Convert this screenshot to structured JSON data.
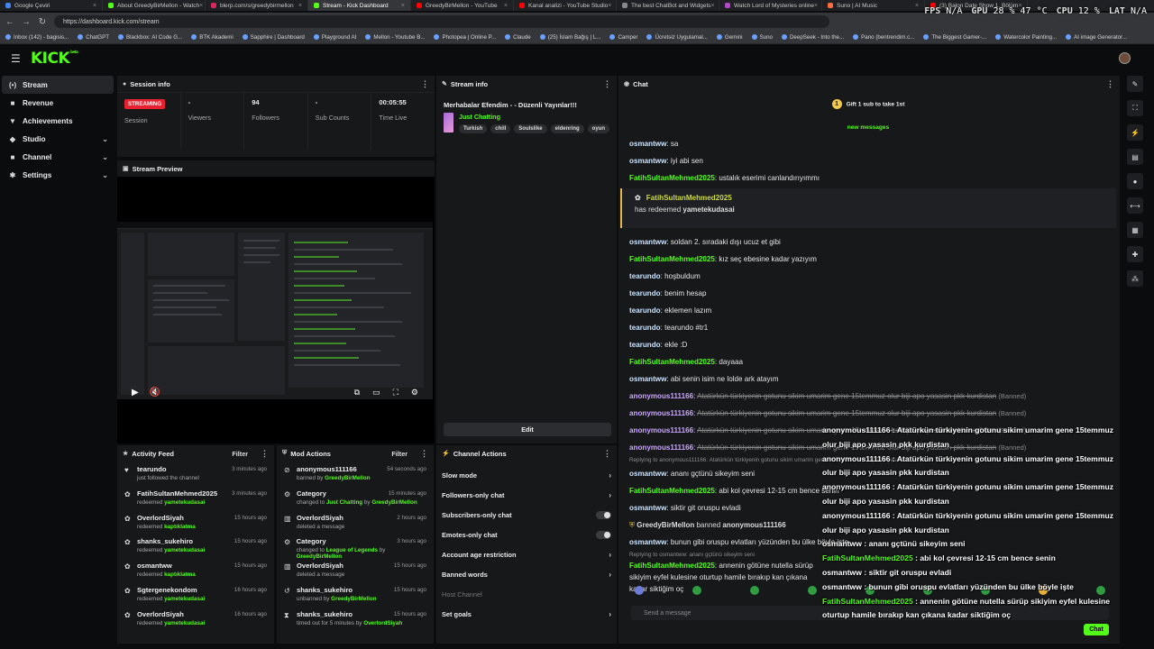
{
  "browser": {
    "tabs": [
      {
        "label": "Google Çeviri",
        "color": "#4285f4"
      },
      {
        "label": "About GreedyBirMellon - Watch",
        "color": "#53fc18"
      },
      {
        "label": "blerp.com/s/greedybirmellon",
        "color": "#e0245e"
      },
      {
        "label": "Stream - Kick Dashboard",
        "color": "#53fc18",
        "active": true
      },
      {
        "label": "GreedyBirMellon - YouTube",
        "color": "#ff0000"
      },
      {
        "label": "Kanal analizi - YouTube Studio",
        "color": "#ff0000"
      },
      {
        "label": "The best ChatBot and Widgets",
        "color": "#888888"
      },
      {
        "label": "Watch Lord of Mysteries online",
        "color": "#b048c8"
      },
      {
        "label": "Suno | AI Music",
        "color": "#ff6b3d"
      },
      {
        "label": "(3) Balon Date Show 1. Bölüm",
        "color": "#ff0000"
      }
    ],
    "url": "https://dashboard.kick.com/stream",
    "bookmarks": [
      "Inbox (142) - bagisis...",
      "ChatGPT",
      "Blackbox: AI Code G...",
      "BTK Akademi",
      "Sapphire | Dashboard",
      "Playground AI",
      "Mellon - Youtube B...",
      "Photopea | Online P...",
      "Claude",
      "(25) İslam Bağış | L...",
      "Camper",
      "Ücretsiz Uygulamal...",
      "Gemini",
      "Suno",
      "DeepSeek - Into the...",
      "Pano (bentrendim.c...",
      "The Biggest Gamer-...",
      "Watercolor Painting...",
      "AI image Generator..."
    ]
  },
  "hud": {
    "fps_label": "FPS",
    "fps": "N/A",
    "gpu_label": "GPU",
    "gpu": "28 % 47 °C",
    "cpu_label": "CPU",
    "cpu": "12 %",
    "lat_label": "LAT",
    "lat": "N/A"
  },
  "brand": {
    "logo": "KICK",
    "logo_sup": "beta"
  },
  "sidebar": {
    "items": [
      {
        "label": "Stream",
        "icon": "stream-icon",
        "glyph": "(•)",
        "active": true
      },
      {
        "label": "Revenue",
        "icon": "revenue-icon",
        "glyph": "■"
      },
      {
        "label": "Achievements",
        "icon": "trophy-icon",
        "glyph": "▼"
      },
      {
        "label": "Studio",
        "icon": "studio-icon",
        "glyph": "◆",
        "chevron": true
      },
      {
        "label": "Channel",
        "icon": "channel-icon",
        "glyph": "■",
        "chevron": true
      },
      {
        "label": "Settings",
        "icon": "gear-icon",
        "glyph": "✱",
        "chevron": true
      }
    ]
  },
  "session": {
    "title": "Session info",
    "status": "STREAMING",
    "status_label": "Session",
    "viewers": "-",
    "viewers_label": "Viewers",
    "followers": "94",
    "followers_label": "Followers",
    "subs": "-",
    "subs_label": "Sub Counts",
    "time": "00:05:55",
    "time_label": "Time Live"
  },
  "preview": {
    "title": "Stream Preview"
  },
  "streaminfo": {
    "title": "Stream info",
    "stream_title": "Merhabalar Efendim - - Düzenli Yayınlar!!!",
    "category": "Just Chatting",
    "tags": [
      "Turkish",
      "chill",
      "Soulslike",
      "eldenring",
      "oyun"
    ],
    "edit": "Edit"
  },
  "chat": {
    "title": "Chat",
    "gift": "Gift 1 sub to take 1st",
    "new_messages": "new messages",
    "messages": [
      {
        "u": "osmantww",
        "c": "#c9e3ff",
        "t": "sa"
      },
      {
        "u": "osmantww",
        "c": "#c9e3ff",
        "t": "iyi abi sen"
      },
      {
        "u": "FatihSultanMehmed2025",
        "c": "#53fc18",
        "t": "ustalık eserimi canlandırıyımmı"
      }
    ],
    "redeem": {
      "u": "FatihSultanMehmed2025",
      "t1": "has redeemed ",
      "t2": "yametekudasai"
    },
    "messages2": [
      {
        "u": "osmantww",
        "c": "#c9e3ff",
        "t": "soldan 2. sıradaki dışı ucuz et gibi"
      },
      {
        "u": "FatihSultanMehmed2025",
        "c": "#53fc18",
        "t": "kız seç ebesine kadar yazıyım"
      },
      {
        "u": "tearundo",
        "c": "#c9e3ff",
        "t": "hoşbuldum"
      },
      {
        "u": "tearundo",
        "c": "#c9e3ff",
        "t": "benim hesap"
      },
      {
        "u": "tearundo",
        "c": "#c9e3ff",
        "t": "eklemen lazım"
      },
      {
        "u": "tearundo",
        "c": "#c9e3ff",
        "t": "tearundo #tr1"
      },
      {
        "u": "tearundo",
        "c": "#c9e3ff",
        "t": "ekle :D"
      },
      {
        "u": "FatihSultanMehmed2025",
        "c": "#53fc18",
        "t": "dayaaa"
      },
      {
        "u": "osmantww",
        "c": "#c9e3ff",
        "t": "abi senin isim ne lolde ark atayım"
      }
    ],
    "banned_msgs": [
      {
        "u": "anonymous111166",
        "t": "Atatürkün türkiyenin gotunu sikim umarim gene 15temmuz olur biji apo yasasin pkk kurdistan",
        "b": "(Banned)"
      },
      {
        "u": "anonymous111166",
        "t": "Atatürkün türkiyenin gotunu sikim umarim gene 15temmuz olur biji apo yasasin pkk kurdistan",
        "b": "(Banned)"
      },
      {
        "u": "anonymous111166",
        "t": "Atatürkün türkiyenin gotunu sikim umarim gene 15temmuz olur biji apo yasasin pkk kurdistan",
        "b": "(Banned)"
      },
      {
        "u": "anonymous111166",
        "t": "Atatürkün türkiyenin gotunu sikim umarim gene 15temmuz olur biji apo yasasin pkk kurdistan",
        "b": "(Banned)"
      }
    ],
    "reply1": "Replying to anonymous111166: Atatürkün türkiyenin gotunu sikim umarim gene 15temmuz olur biji apo yasasin...",
    "messages3": [
      {
        "u": "osmantww",
        "c": "#c9e3ff",
        "t": "ananı gçtünü sikeyim seni"
      },
      {
        "u": "FatihSultanMehmed2025",
        "c": "#53fc18",
        "t": "abi kol çevresi 12-15 cm bence senin"
      },
      {
        "u": "osmantww",
        "c": "#c9e3ff",
        "t": "siktir git oruspu evladi"
      }
    ],
    "mod": {
      "u": "GreedyBirMellon",
      "action": "banned",
      "target": "anonymous111166"
    },
    "messages4": [
      {
        "u": "osmantww",
        "c": "#c9e3ff",
        "t": "bunun gibi oruspu evlatları yüzünden bu ülke böyle işte"
      }
    ],
    "reply2": "Replying to osmantww: ananı gçtünü sikeyim seni",
    "last": {
      "u": "FatihSultanMehmed2025",
      "t": "annenin götüne nutella sürüp sikiyim eyfel kulesine oturtup hamile bırakıp kan çıkana kadar siktiğim oç"
    },
    "input_placeholder": "Send a message",
    "send": "Chat"
  },
  "overlay": [
    {
      "u": "anonymous111166",
      "t": "Atatürkün türkiyenin gotunu sikim umarim gene 15temmuz olur biji apo yasasin pkk kurdistan"
    },
    {
      "u": "anonymous111166",
      "t": "Atatürkün türkiyenin gotunu sikim umarim gene 15temmuz olur biji apo yasasin pkk kurdistan"
    },
    {
      "u": "anonymous111166",
      "t": "Atatürkün türkiyenin gotunu sikim umarim gene 15temmuz olur biji apo yasasin pkk kurdistan"
    },
    {
      "u": "anonymous111166",
      "t": "Atatürkün türkiyenin gotunu sikim umarim gene 15temmuz olur biji apo yasasin pkk kurdistan"
    },
    {
      "u": "osmantww",
      "t": "ananı gçtünü sikeyim seni"
    },
    {
      "u": "FatihSultanMehmed2025",
      "t": "abi kol çevresi 12-15 cm bence senin",
      "g": true
    },
    {
      "u": "osmantww",
      "t": "siktir git oruspu evladi"
    },
    {
      "u": "osmantww",
      "t": "bunun gibi oruspu evlatları yüzünden bu ülke böyle işte"
    },
    {
      "u": "FatihSultanMehmed2025",
      "t": "annenin götüne nutella sürüp sikiyim eyfel kulesine oturtup hamile bırakıp kan çıkana kadar siktiğim oç",
      "g": true
    }
  ],
  "activity": {
    "title": "Activity Feed",
    "filter": "Filter",
    "items": [
      {
        "icon": "heart-icon",
        "glyph": "♥",
        "name": "tearundo",
        "sub": "just followed the channel",
        "time": "3 minutes ago"
      },
      {
        "icon": "redeem-icon",
        "glyph": "✿",
        "name": "FatihSultanMehmed2025",
        "sub_pre": "redeemed ",
        "sub_b": "yametekudasai",
        "time": "3 minutes ago"
      },
      {
        "icon": "redeem-icon",
        "glyph": "✿",
        "name": "OverlordSiyah",
        "sub_pre": "redeemed ",
        "sub_b": "kaptıklatma",
        "time": "15 hours ago"
      },
      {
        "icon": "redeem-icon",
        "glyph": "✿",
        "name": "shanks_sukehiro",
        "sub_pre": "redeemed ",
        "sub_b": "yametekudasai",
        "time": "15 hours ago"
      },
      {
        "icon": "redeem-icon",
        "glyph": "✿",
        "name": "osmantww",
        "sub_pre": "redeemed ",
        "sub_b": "kaptıklatma",
        "time": "15 hours ago"
      },
      {
        "icon": "redeem-icon",
        "glyph": "✿",
        "name": "Sgtergenekondom",
        "sub_pre": "redeemed ",
        "sub_b": "yametekudasai",
        "time": "16 hours ago"
      },
      {
        "icon": "redeem-icon",
        "glyph": "✿",
        "name": "OverlordSiyah",
        "sub_pre": "redeemed ",
        "sub_b": "yametekudasai",
        "time": "16 hours ago"
      }
    ]
  },
  "mod": {
    "title": "Mod Actions",
    "filter": "Filter",
    "items": [
      {
        "icon": "ban-icon",
        "glyph": "⊘",
        "name": "anonymous111166",
        "sub_pre": "banned by ",
        "sub_b": "GreedyBirMellon",
        "time": "54 seconds ago"
      },
      {
        "icon": "category-icon",
        "glyph": "⚙",
        "name": "Category",
        "sub_pre": "changed to ",
        "sub_b": "Just Chatting",
        "sub_post": " by ",
        "sub_b2": "GreedyBirMellon",
        "time": "15 minutes ago"
      },
      {
        "icon": "trash-icon",
        "glyph": "▥",
        "name": "OverlordSiyah",
        "sub_pre": "deleted a message",
        "time": "2 hours ago"
      },
      {
        "icon": "category-icon",
        "glyph": "⚙",
        "name": "Category",
        "sub_pre": "changed to ",
        "sub_b": "League of Legends",
        "sub_post": " by ",
        "sub_b2": "GreedyBirMellon",
        "time": "3 hours ago"
      },
      {
        "icon": "trash-icon",
        "glyph": "▥",
        "name": "OverlordSiyah",
        "sub_pre": "deleted a message",
        "time": "15 hours ago"
      },
      {
        "icon": "unban-icon",
        "glyph": "↺",
        "name": "shanks_sukehiro",
        "sub_pre": "unbanned by ",
        "sub_b": "GreedyBirMellon",
        "time": "15 hours ago"
      },
      {
        "icon": "timeout-icon",
        "glyph": "⧗",
        "name": "shanks_sukehiro",
        "sub_pre": "timed out for 5 minutes by ",
        "sub_b": "OverlordSiyah",
        "time": "15 hours ago"
      }
    ]
  },
  "channel_actions": {
    "title": "Channel Actions",
    "items": [
      {
        "label": "Slow mode",
        "kind": "chev"
      },
      {
        "label": "Followers-only chat",
        "kind": "chev"
      },
      {
        "label": "Subscribers-only chat",
        "kind": "toggle"
      },
      {
        "label": "Emotes-only chat",
        "kind": "toggle"
      },
      {
        "label": "Account age restriction",
        "kind": "chev"
      },
      {
        "label": "Banned words",
        "kind": "chev"
      },
      {
        "label": "Host Channel",
        "kind": "dim"
      },
      {
        "label": "Set goals",
        "kind": "chev"
      }
    ]
  },
  "rail": [
    {
      "icon": "edit-icon",
      "glyph": "✎"
    },
    {
      "icon": "clip-icon",
      "glyph": "⛶"
    },
    {
      "icon": "bolt-icon",
      "glyph": "⚡"
    },
    {
      "icon": "note-icon",
      "glyph": "▤"
    },
    {
      "icon": "chat-bubble-icon",
      "glyph": "●"
    },
    {
      "icon": "link-icon",
      "glyph": "⟷"
    },
    {
      "icon": "calendar-icon",
      "glyph": "▦"
    },
    {
      "icon": "wrench-icon",
      "glyph": "✚"
    },
    {
      "icon": "group-icon",
      "glyph": "⁂"
    }
  ]
}
